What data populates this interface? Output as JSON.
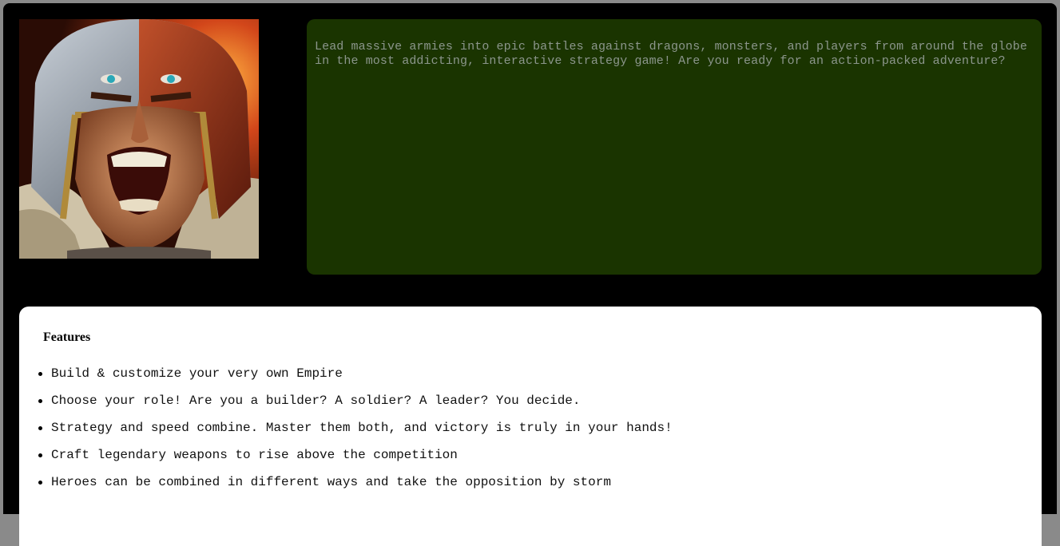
{
  "hero": {
    "image_icon": "warrior-helmet-portrait"
  },
  "description": {
    "text": "Lead massive armies into epic battles against dragons, monsters, and players from around the globe in the most addicting, interactive strategy game! Are you ready for an action-packed adventure?"
  },
  "features": {
    "title": "Features",
    "items": [
      "Build & customize your very own Empire",
      "Choose your role! Are you a builder? A soldier? A leader? You decide.",
      "Strategy and speed combine. Master them both, and victory is truly in your hands!",
      "Craft legendary weapons to rise above the competition",
      "Heroes can be combined in different ways and take the opposition by storm"
    ]
  },
  "colors": {
    "page_background": "#000000",
    "description_background": "#1a3400",
    "description_text": "#8c968c",
    "features_background": "#ffffff"
  }
}
